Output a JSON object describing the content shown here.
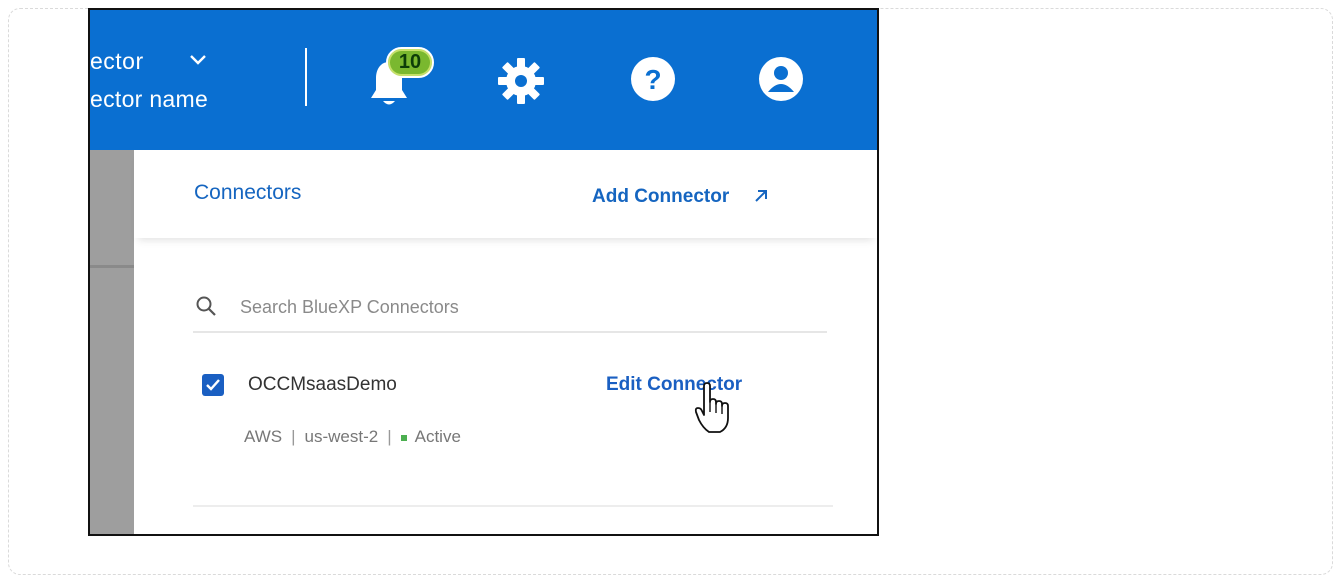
{
  "header": {
    "connector_label": "ector",
    "connector_name": "ector name",
    "notifications_count": "10"
  },
  "panel": {
    "title": "Connectors",
    "add_connector": "Add Connector",
    "search_placeholder": "Search BlueXP Connectors"
  },
  "connector": {
    "name": "OCCMsaasDemo",
    "edit_label": "Edit Connector",
    "provider": "AWS",
    "region": "us-west-2",
    "status": "Active",
    "checked": true
  },
  "colors": {
    "header_bg": "#0a6fd1",
    "link": "#1565c0",
    "badge": "#7ab82f",
    "status_active": "#4caf50"
  }
}
